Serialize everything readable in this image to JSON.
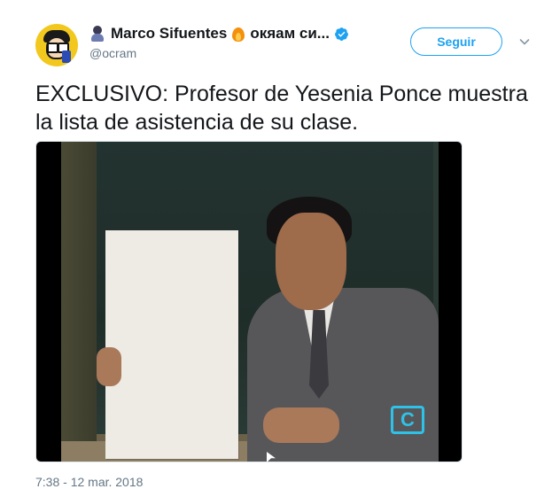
{
  "tweet": {
    "author": {
      "display_name": "Marco Sifuentes",
      "display_name_suffix": "окяам си...",
      "handle": "@ocram",
      "avatar_icon": "cartoon-avatar-glasses",
      "verified": true
    },
    "follow_label": "Seguir",
    "text": "EXCLUSIVO: Profesor de Yesenia Ponce muestra la lista de asistencia de su clase.",
    "media": {
      "channel_logo_text": "C"
    },
    "timestamp": "7:38 - 12 mar. 2018"
  },
  "colors": {
    "accent": "#1da1f2",
    "text_primary": "#14171a",
    "text_secondary": "#657786",
    "channel_logo": "#2fc2e8"
  },
  "icons": {
    "verified": "verified-badge-icon",
    "menu": "chevron-down-icon",
    "gesture": "person-gesturing-emoji",
    "fire": "fire-emoji"
  }
}
